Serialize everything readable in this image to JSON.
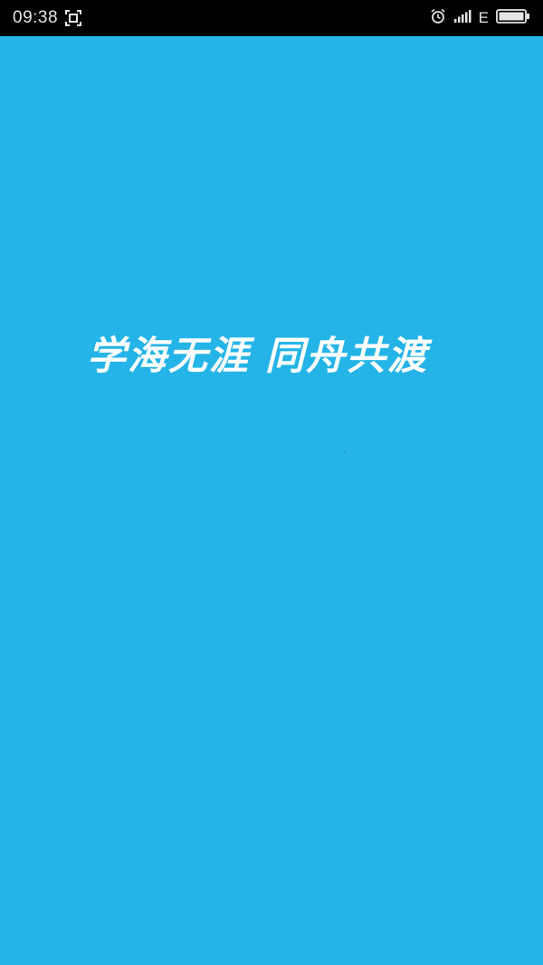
{
  "status_bar": {
    "time": "09:38",
    "network_type": "E",
    "icons": [
      "screenshot-icon",
      "alarm-icon",
      "signal-icon",
      "battery-icon"
    ]
  },
  "splash": {
    "slogan": "学海无涯 同舟共渡",
    "background_color": "#24b4e8"
  }
}
